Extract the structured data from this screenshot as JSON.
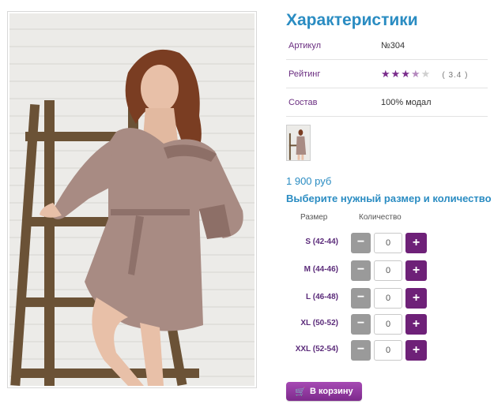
{
  "product": {
    "image_alt": "",
    "title": "Характеристики",
    "specs": [
      {
        "key": "Артикул",
        "value": "№304"
      },
      {
        "key": "Рейтинг",
        "rating": 3.4,
        "rating_text": "( 3.4 )",
        "stars_total": 5
      },
      {
        "key": "Состав",
        "value": "100% модал"
      }
    ],
    "price": "1 900 руб",
    "choose_text": "Выберите нужный размер и количество",
    "table_headers": {
      "size": "Размер",
      "qty": "Количество"
    },
    "sizes": [
      {
        "label": "S (42-44)",
        "qty": "0"
      },
      {
        "label": "M (44-46)",
        "qty": "0"
      },
      {
        "label": "L (46-48)",
        "qty": "0"
      },
      {
        "label": "XL (50-52)",
        "qty": "0"
      },
      {
        "label": "XXL (52-54)",
        "qty": "0"
      }
    ],
    "minus_label": "−",
    "plus_label": "+",
    "cart_label": "В корзину",
    "cart_icon": "cart-icon"
  },
  "colors": {
    "accent": "#2a8cc2",
    "purple": "#6e2178",
    "gray_button": "#9a9a9a"
  }
}
